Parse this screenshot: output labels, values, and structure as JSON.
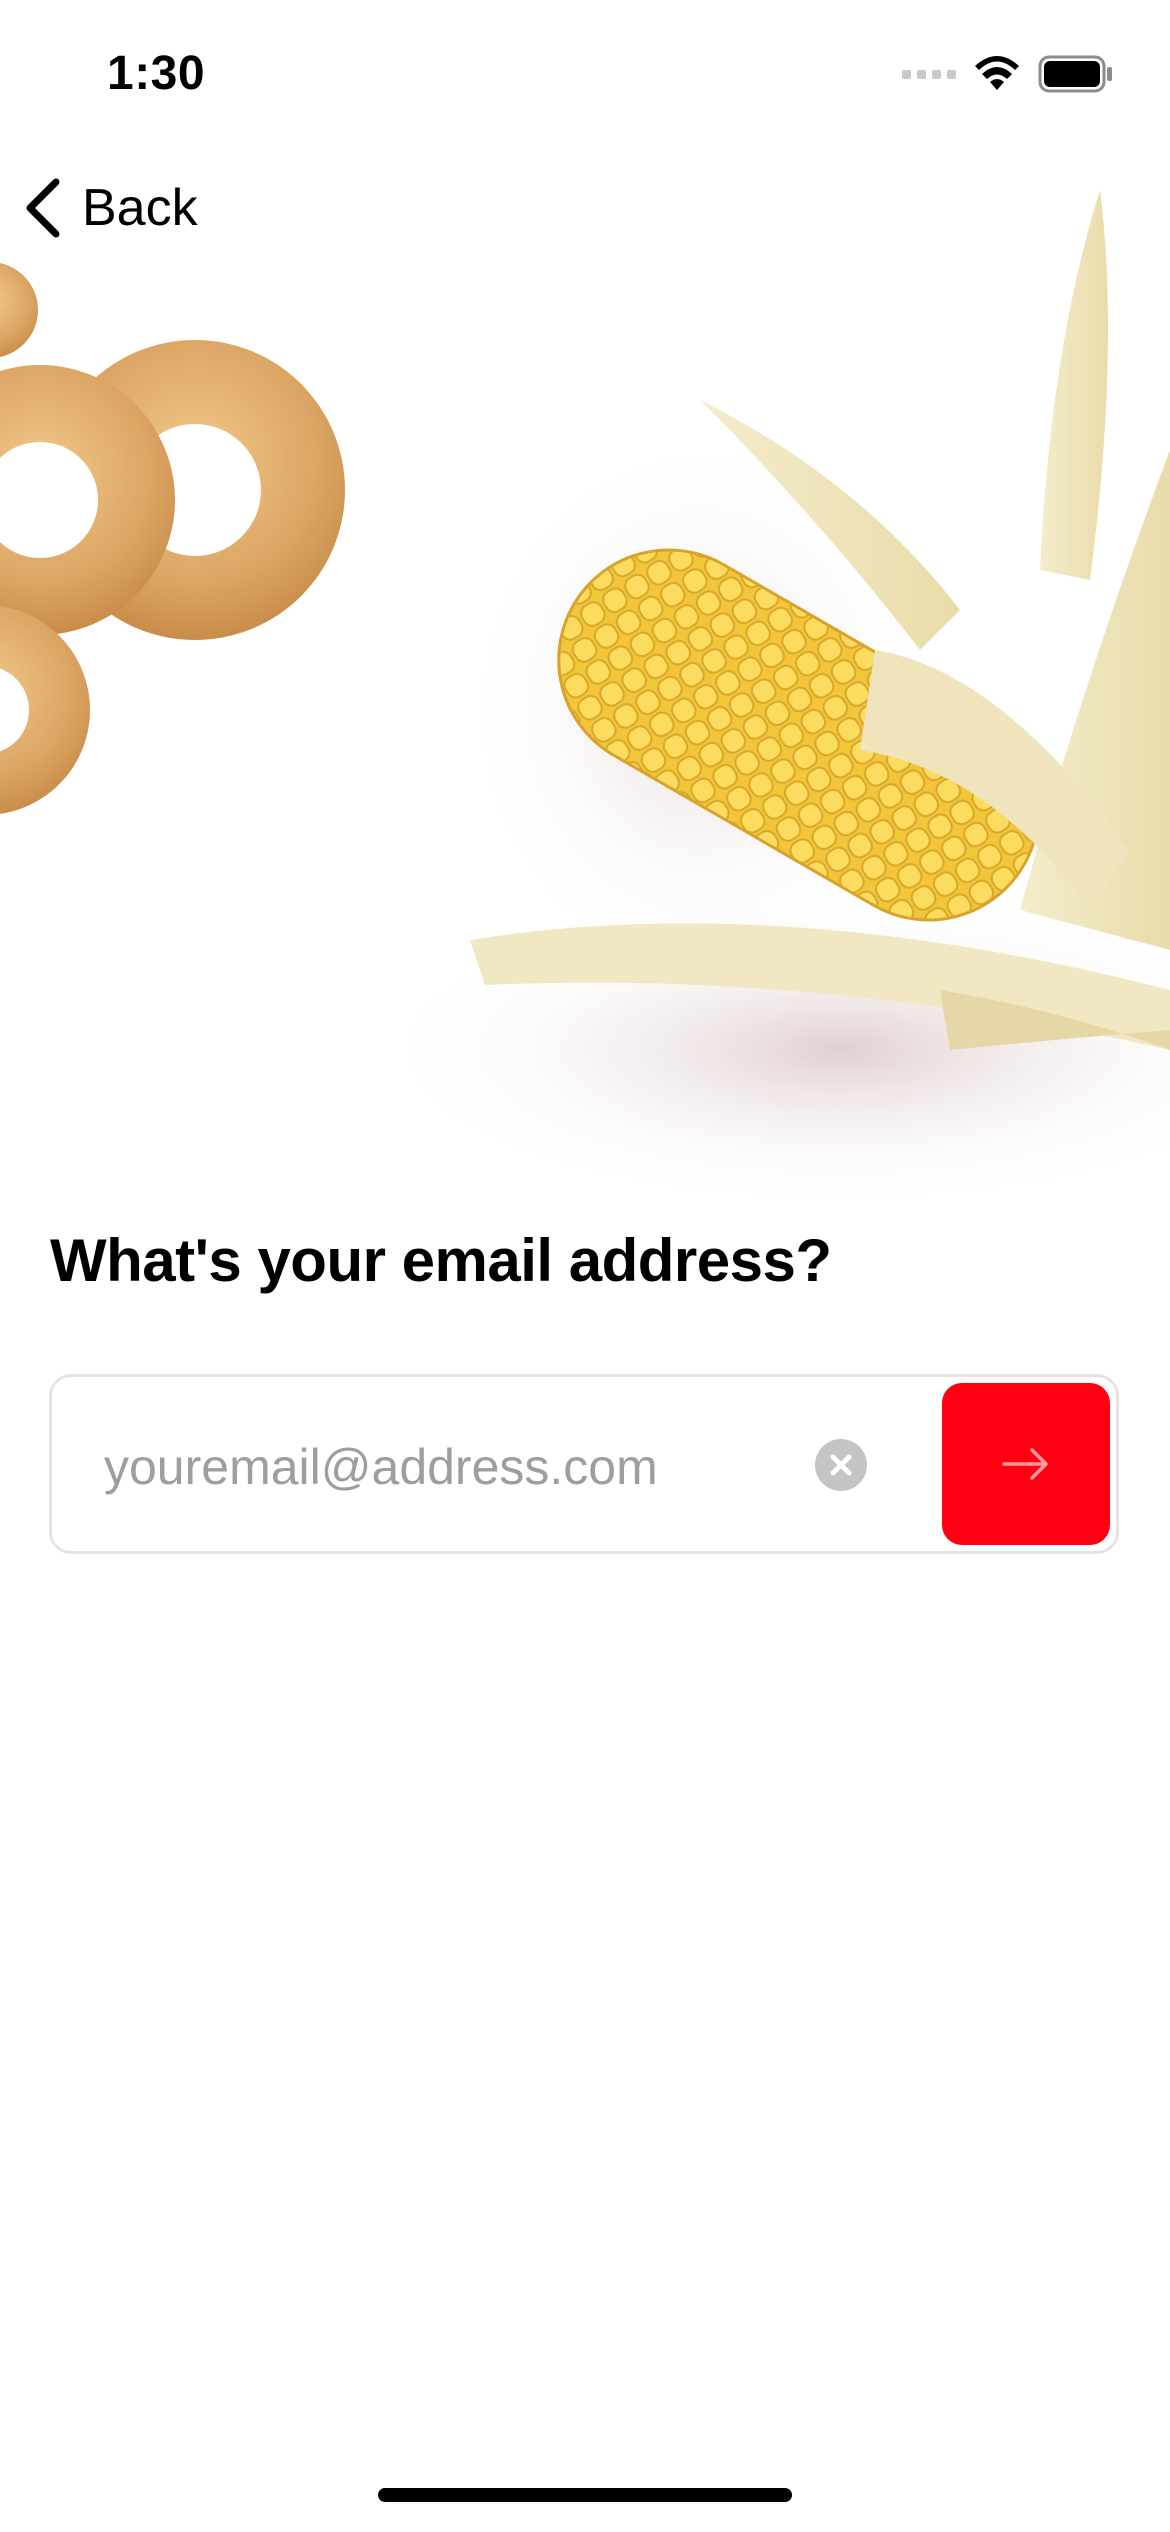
{
  "status_bar": {
    "time": "1:30",
    "signal_icon": "cellular-signal-icon",
    "wifi_icon": "wifi-icon",
    "battery_icon": "battery-icon"
  },
  "nav": {
    "back_label": "Back",
    "back_icon": "chevron-left-icon"
  },
  "hero": {
    "images": [
      "bagels-photo",
      "corn-cob-photo"
    ]
  },
  "form": {
    "question": "What's your email address?",
    "email_placeholder": "youremail@address.com",
    "email_value": "",
    "clear_icon": "clear-x-icon",
    "submit_icon": "arrow-right-icon"
  },
  "colors": {
    "accent": "#ff0013",
    "placeholder": "#9e9e9e",
    "border": "#e4e4e4"
  }
}
